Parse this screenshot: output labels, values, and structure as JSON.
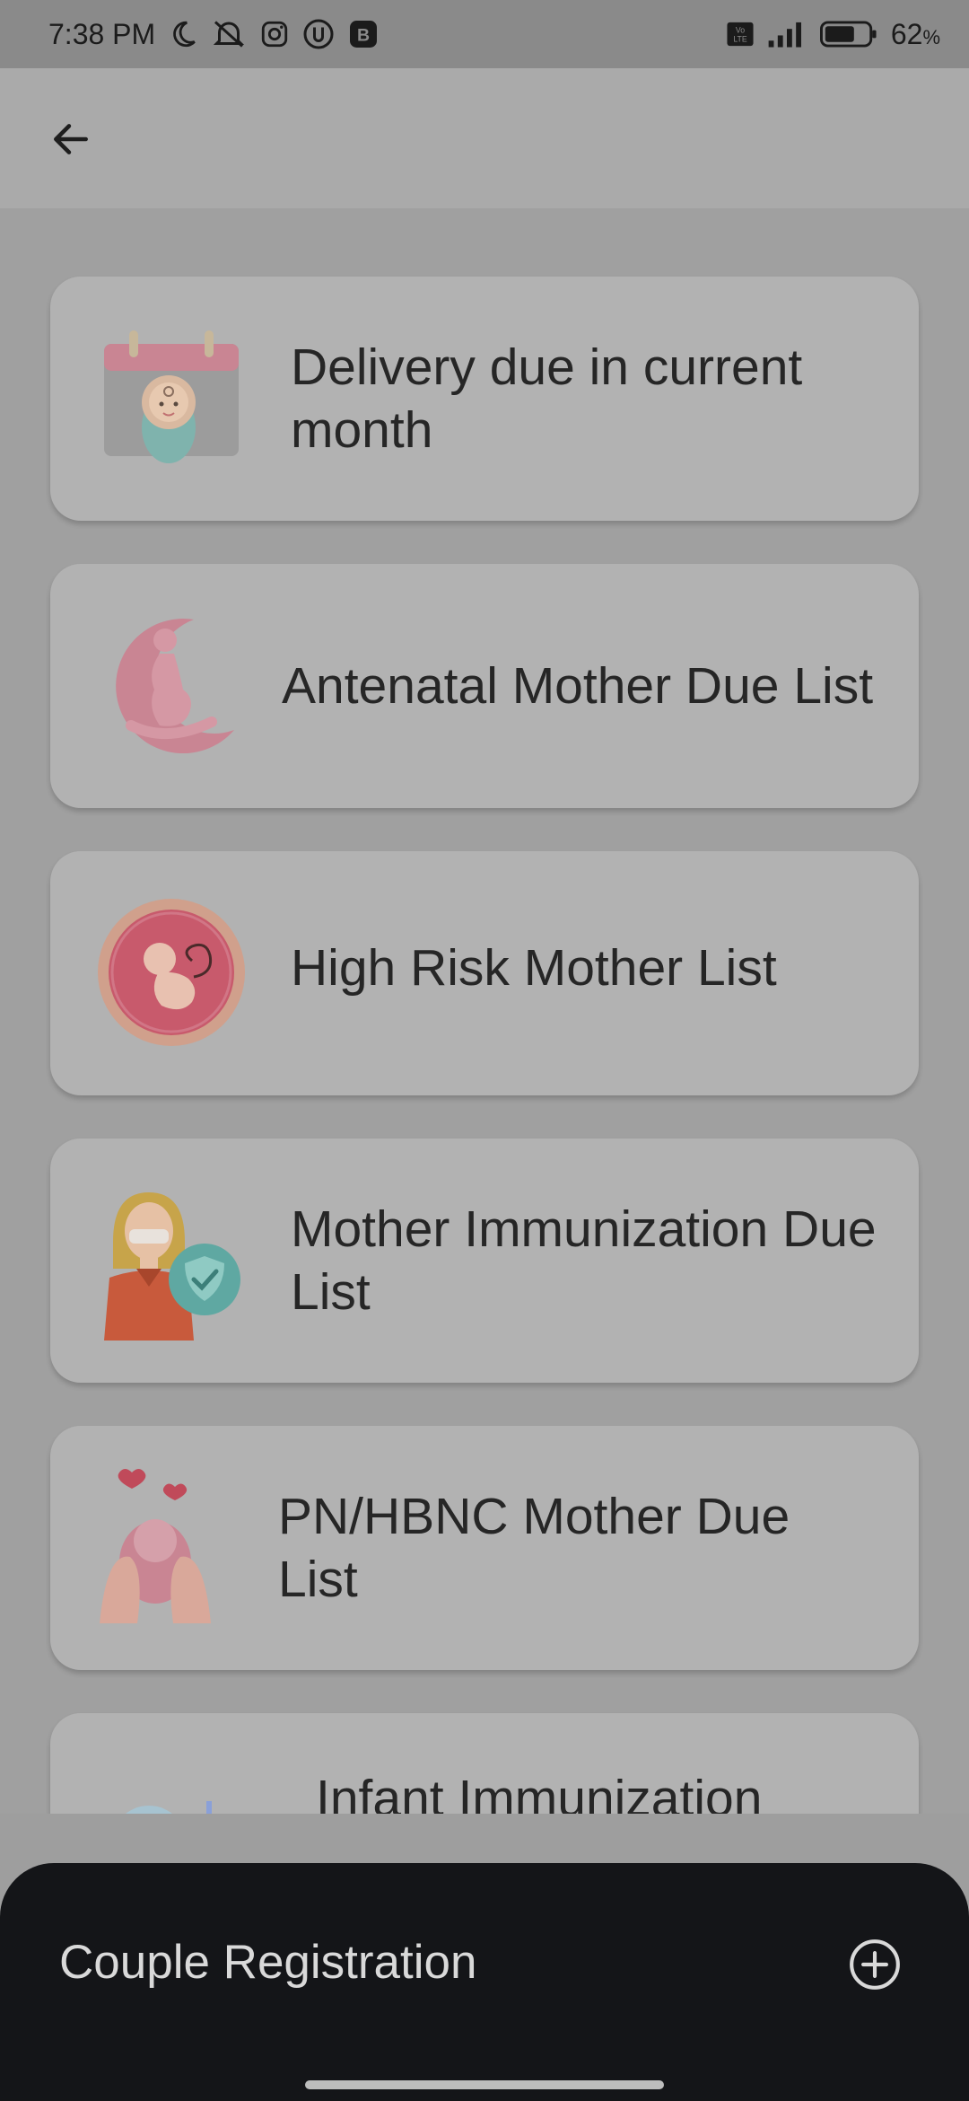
{
  "status_bar": {
    "time": "7:38 PM",
    "battery_percent": "62",
    "battery_unit": "%",
    "icons": [
      "moon-icon",
      "notifications-off-icon",
      "instagram-icon",
      "app-icon",
      "b-icon",
      "volte-icon",
      "signal-icon",
      "battery-icon"
    ]
  },
  "app_bar": {
    "back_icon": "arrow-left-icon"
  },
  "list": {
    "items": [
      {
        "label": "Delivery due in current month",
        "icon": "calendar-baby-icon"
      },
      {
        "label": "Antenatal Mother Due List",
        "icon": "pregnant-mother-icon"
      },
      {
        "label": "High Risk Mother List",
        "icon": "fetus-icon"
      },
      {
        "label": "Mother Immunization Due List",
        "icon": "mother-shield-icon"
      },
      {
        "label": "PN/HBNC Mother Due List",
        "icon": "hands-baby-icon"
      },
      {
        "label": "Infant Immunization",
        "icon": "infant-vaccine-icon"
      }
    ]
  },
  "bottom_sheet": {
    "title": "Couple Registration",
    "action_icon": "plus-circle-icon"
  },
  "colors": {
    "scrim": "#9e9e9e",
    "card": "#b2b2b2",
    "sheet": "#141518",
    "pink": "#c98593",
    "teal": "#5fa8a2"
  }
}
